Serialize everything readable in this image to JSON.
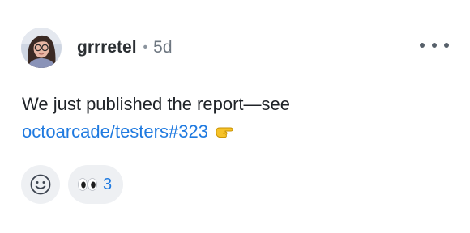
{
  "post": {
    "username": "grrretel",
    "separator": "•",
    "time_ago": "5d",
    "text_line1": "We just published the report—see",
    "link_text": "octoarcade/testers#323",
    "point_emoji": "backhand-index-pointing-right"
  },
  "reactions": {
    "add_reaction_icon": "smiley-face-icon",
    "items": [
      {
        "emoji": "eyes",
        "count": "3"
      }
    ]
  },
  "colors": {
    "link": "#1f7ae0",
    "pill_background": "#eef0f3",
    "muted_text": "#6e7781"
  }
}
